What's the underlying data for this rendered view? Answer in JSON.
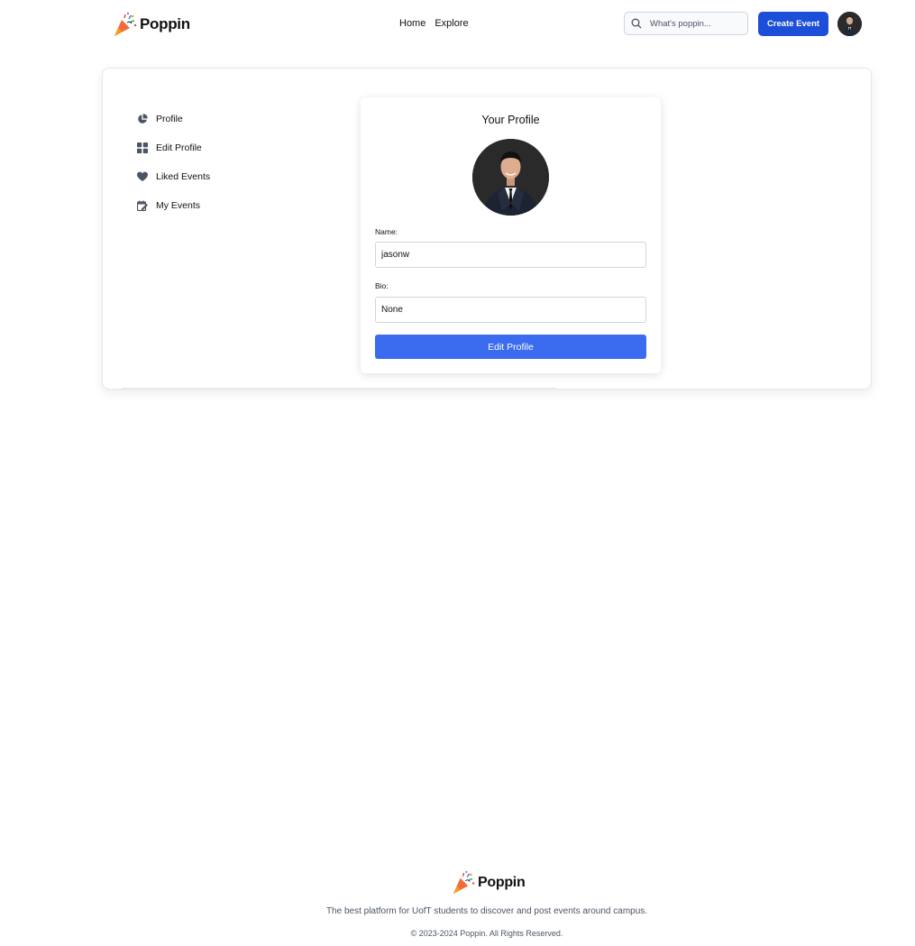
{
  "header": {
    "brand": "Poppin",
    "nav": [
      {
        "label": "Home"
      },
      {
        "label": "Explore"
      }
    ],
    "search_placeholder": "What's poppin...",
    "create_button": "Create Event"
  },
  "sidebar": {
    "items": [
      {
        "label": "Profile",
        "icon": "pie-chart-icon"
      },
      {
        "label": "Edit Profile",
        "icon": "grid-icon"
      },
      {
        "label": "Liked Events",
        "icon": "heart-icon"
      },
      {
        "label": "My Events",
        "icon": "calendar-edit-icon"
      }
    ]
  },
  "profile": {
    "title": "Your Profile",
    "name_label": "Name:",
    "name_value": "jasonw",
    "bio_label": "Bio:",
    "bio_value": "None",
    "edit_button": "Edit Profile"
  },
  "footer": {
    "brand": "Poppin",
    "tagline": "The best platform for UofT students to discover and post events around campus.",
    "copyright": "© 2023-2024 Poppin. All Rights Reserved."
  },
  "colors": {
    "primary": "#1d4ed8",
    "edit_button": "#3b6cf0",
    "icon_gray": "#4b5563"
  }
}
